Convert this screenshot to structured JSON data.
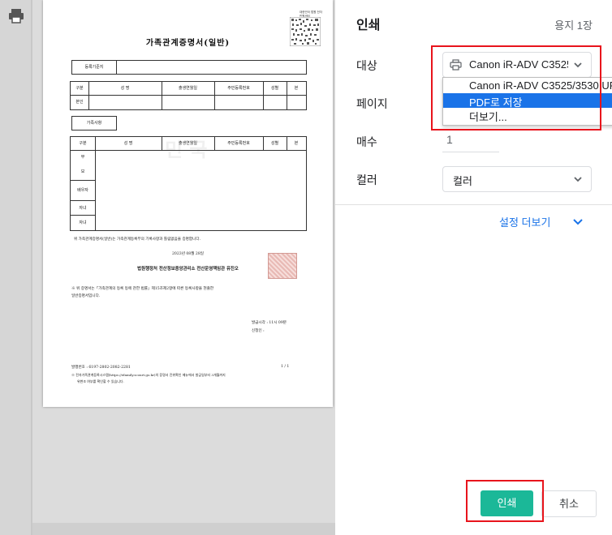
{
  "preview": {
    "doc_title": "가족관계증명서(일반)",
    "qr_caption": "대한민국 법원 전자민원센터",
    "registration_base_label": "등록기준지",
    "table1_headers": [
      "구분",
      "성 명",
      "출생연월일",
      "주민등록번호",
      "성별",
      "본"
    ],
    "table1_row_label": "본인",
    "family_section_label": "가족사항",
    "table2_headers": [
      "구분",
      "성 명",
      "출생연월일",
      "주민등록번호",
      "성별",
      "본"
    ],
    "family_row_labels": [
      "부",
      "모",
      "배우자",
      "자녀",
      "자녀"
    ],
    "certify_text": "위 가족관계증명서(일반)는 가족관계등록부의 기록사항과 틀림없음을 증명합니다.",
    "issue_date": "2023년 08월 28일",
    "issuer": "법원행정처 전산정보중앙관리소 전산운영책임관 유진오",
    "notice_text_1": "※ 위 증명서는「가족관계의 등록 등에 관한 법률」제15조제2항에 따른 등록사항을 현출한",
    "notice_text_2": "일반증명서입니다.",
    "issue_time": "발급시각 : 11시 09분",
    "applicant": "신청인 :",
    "doc_number": "발행번호 : 6197-2802-2082-2281",
    "page_count": "1 / 1",
    "footer_1": "※ 전자가족관계등록시스템(https://efamily.scourt.go.kr)의 증명서 진위확인 메뉴에서 발급일부터 3개월까지",
    "footer_2": "위변조 여부를 확인할 수 있습니다.",
    "watermark": "민 국"
  },
  "panel": {
    "title": "인쇄",
    "sheets": "용지 1장",
    "destination_label": "대상",
    "destination_value": "Canon iR-ADV C3525",
    "pages_label": "페이지",
    "copies_label": "매수",
    "copies_value": "1",
    "color_label": "컬러",
    "color_value": "컬러",
    "more_settings": "설정 더보기",
    "dropdown_items": [
      "Canon iR-ADV C3525/3530 UF",
      "PDF로 저장",
      "더보기..."
    ],
    "dropdown_selected": "PDF로 저장",
    "print_button": "인쇄",
    "cancel_button": "취소"
  },
  "colors": {
    "accent": "#1a73e8",
    "print_button": "#1bb898",
    "highlight_box": "#e8141c"
  },
  "icons": [
    "printer-icon",
    "chevron-down-icon"
  ]
}
